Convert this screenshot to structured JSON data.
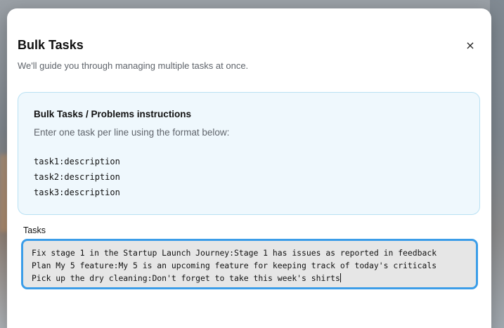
{
  "modal": {
    "title": "Bulk Tasks",
    "subtitle": "We'll guide you through managing multiple tasks at once.",
    "close_icon": "×"
  },
  "instructions": {
    "title": "Bulk Tasks / Problems instructions",
    "description": "Enter one task per line using the format below:",
    "format_lines": [
      "task1:description",
      "task2:description",
      "task3:description"
    ]
  },
  "tasks": {
    "label": "Tasks",
    "lines": [
      "Fix stage 1 in the Startup Launch Journey:Stage 1 has issues as reported in feedback",
      "Plan My 5 feature:My 5 is an upcoming feature for keeping track of today's criticals",
      "Pick up the dry cleaning:Don't forget to take this week's shirts"
    ]
  },
  "colors": {
    "accent": "#3b9de8",
    "info_background": "#eff8fd",
    "info_border": "#b9e1f3",
    "field_background": "#e6e6e6"
  }
}
